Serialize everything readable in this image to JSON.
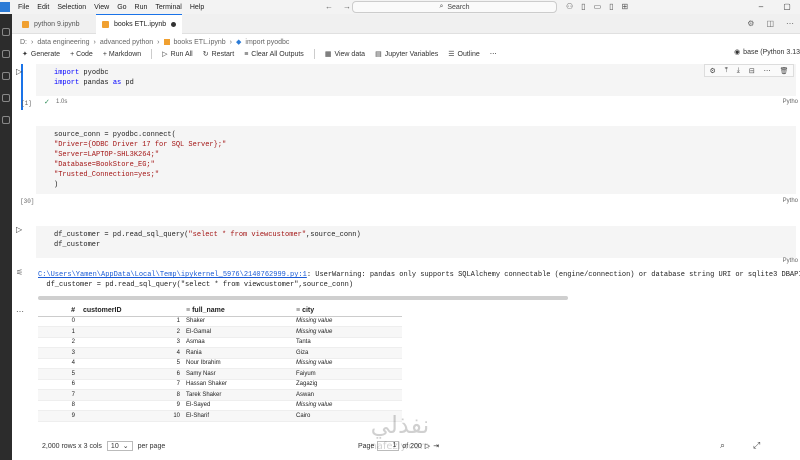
{
  "menu": [
    "File",
    "Edit",
    "Selection",
    "View",
    "Go",
    "Run",
    "Terminal",
    "Help"
  ],
  "search_label": "Search",
  "tabs": [
    {
      "label": "python 9.ipynb"
    },
    {
      "label": "books ETL.ipynb",
      "active": true
    }
  ],
  "breadcrumb": [
    "D:",
    "data engineering",
    "advanced python",
    "books ETL.ipynb",
    "import pyodbc"
  ],
  "toolbar": {
    "generate": "Generate",
    "code": "+ Code",
    "markdown": "+ Markdown",
    "run_all": "Run All",
    "restart": "Restart",
    "clear": "Clear All Outputs",
    "view_data": "View data",
    "jupyter_vars": "Jupyter Variables",
    "outline": "Outline",
    "kernel": "base (Python 3.13"
  },
  "cells": {
    "c1": {
      "exec": "[1]",
      "time": "1.0s",
      "lang": "Pytho"
    },
    "c2": {
      "exec": "[30]",
      "lang": "Pytho"
    },
    "c3": {
      "lang": "Pytho"
    }
  },
  "warning": {
    "path": "C:\\Users\\Yamen\\AppData\\Local\\Temp\\ipykernel_5976\\2140762999.py:1",
    "message": ": UserWarning: pandas only supports SQLAlchemy connectable (engine/connection) or database string URI or sqlite3 DBAPI2",
    "line2": "  df_customer = pd.read_sql_query(\"select * from viewcustomer\",source_conn)"
  },
  "table": {
    "columns": [
      "customerID",
      "full_name",
      "city"
    ],
    "index_symbol": "#",
    "rows": [
      {
        "idx": "0",
        "id": "1",
        "name": "Shaker",
        "city": "Missing value",
        "missing": true
      },
      {
        "idx": "1",
        "id": "2",
        "name": "El-Gamal",
        "city": "Missing value",
        "missing": true
      },
      {
        "idx": "2",
        "id": "3",
        "name": "Asmaa",
        "city": "Tanta",
        "missing": false
      },
      {
        "idx": "3",
        "id": "4",
        "name": "Rania",
        "city": "Giza",
        "missing": false
      },
      {
        "idx": "4",
        "id": "5",
        "name": "Nour Ibrahim",
        "city": "Missing value",
        "missing": true
      },
      {
        "idx": "5",
        "id": "6",
        "name": "Samy Nasr",
        "city": "Faiyum",
        "missing": false
      },
      {
        "idx": "6",
        "id": "7",
        "name": "Hassan Shaker",
        "city": "Zagazig",
        "missing": false
      },
      {
        "idx": "7",
        "id": "8",
        "name": "Tarek Shaker",
        "city": "Aswan",
        "missing": false
      },
      {
        "idx": "8",
        "id": "9",
        "name": "El-Sayed",
        "city": "Missing value",
        "missing": true
      },
      {
        "idx": "9",
        "id": "10",
        "name": "El-Sharif",
        "city": "Cairo",
        "missing": false
      }
    ]
  },
  "footer": {
    "rows_cols": "2,000 rows x 3 cols",
    "per_page_value": "10",
    "per_page_label": "per page",
    "page_label": "Page",
    "page_value": "1",
    "of_pages": "of 200"
  },
  "watermark_text": "nafezly.com",
  "watermark_arabic": "نفذلي",
  "colors": {
    "accent": "#1a73e8",
    "string": "#a31515",
    "keyword": "#0000ff"
  }
}
